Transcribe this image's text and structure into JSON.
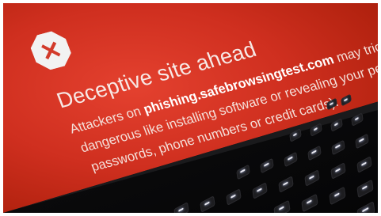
{
  "warning": {
    "icon": "close-x-icon",
    "badge_color": "#f2f2f2",
    "icon_color": "#d23a2a",
    "background_color": "#cf2f1f",
    "title": "Deceptive site ahead",
    "line1_prefix": "Attackers on ",
    "line1_site": "phishing.safebrowsingtest.com",
    "line1_suffix": " may trick you into d",
    "line2": "dangerous like installing software or revealing your personal info",
    "line3": "passwords, phone numbers or credit cards)."
  }
}
